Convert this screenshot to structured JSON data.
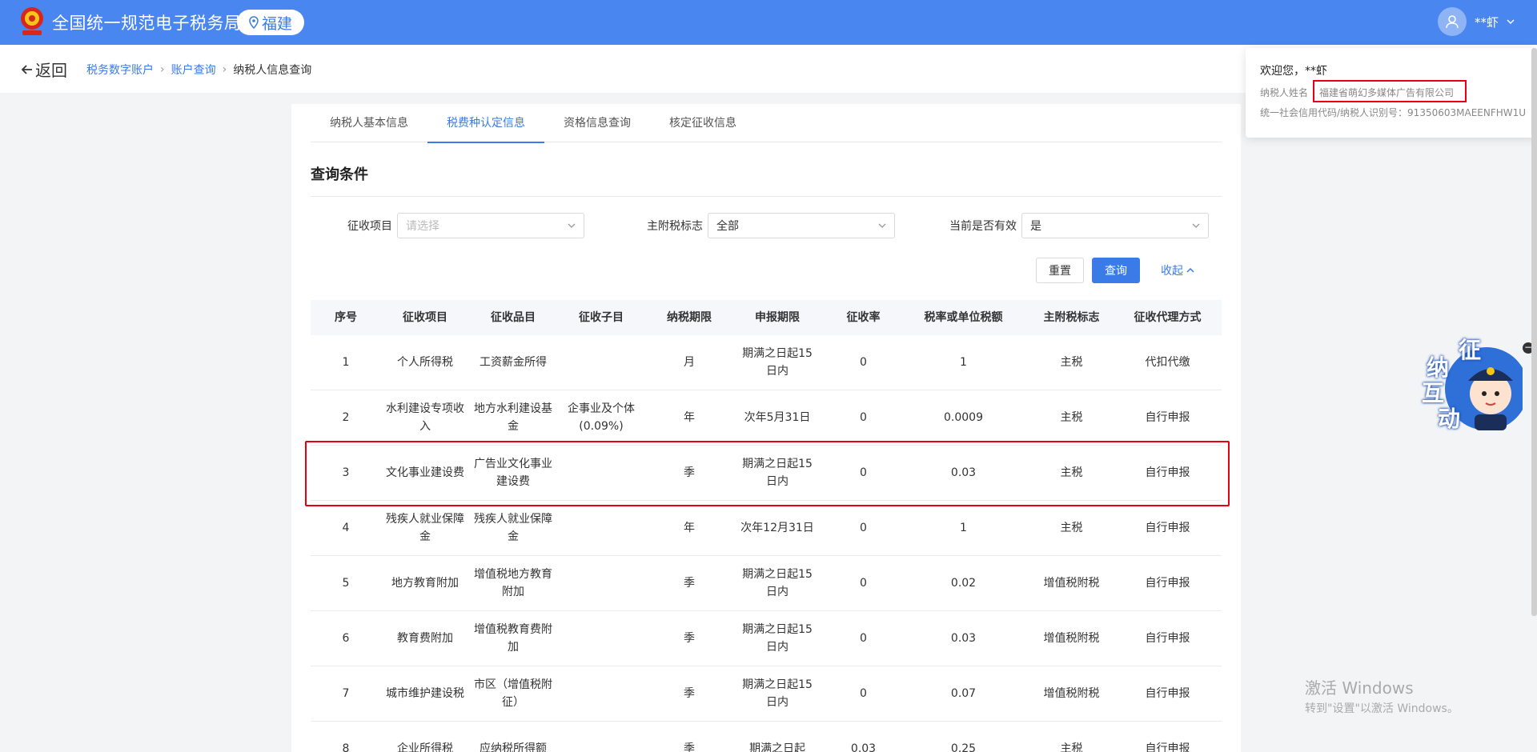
{
  "header": {
    "title": "全国统一规范电子税务局",
    "region": "福建",
    "user": "**虾"
  },
  "nav": {
    "back_label": "返回",
    "breadcrumb": [
      "税务数字账户",
      "账户查询",
      "纳税人信息查询"
    ]
  },
  "tabs": [
    "纳税人基本信息",
    "税费种认定信息",
    "资格信息查询",
    "核定征收信息"
  ],
  "query": {
    "title": "查询条件",
    "fields": [
      {
        "label": "征收项目",
        "value": "",
        "placeholder": "请选择"
      },
      {
        "label": "主附税标志",
        "value": "全部",
        "placeholder": ""
      },
      {
        "label": "当前是否有效",
        "value": "是",
        "placeholder": ""
      }
    ],
    "reset_label": "重置",
    "query_label": "查询",
    "collapse_label": "收起"
  },
  "table": {
    "columns": [
      "序号",
      "征收项目",
      "征收品目",
      "征收子目",
      "纳税期限",
      "申报期限",
      "征收率",
      "税率或单位税额",
      "主附税标志",
      "征收代理方式"
    ],
    "rows": [
      [
        "1",
        "个人所得税",
        "工资薪金所得",
        "",
        "月",
        "期满之日起15日内",
        "0",
        "1",
        "主税",
        "代扣代缴"
      ],
      [
        "2",
        "水利建设专项收入",
        "地方水利建设基金",
        "企事业及个体(0.09%)",
        "年",
        "次年5月31日",
        "0",
        "0.0009",
        "主税",
        "自行申报"
      ],
      [
        "3",
        "文化事业建设费",
        "广告业文化事业建设费",
        "",
        "季",
        "期满之日起15日内",
        "0",
        "0.03",
        "主税",
        "自行申报"
      ],
      [
        "4",
        "残疾人就业保障金",
        "残疾人就业保障金",
        "",
        "年",
        "次年12月31日",
        "0",
        "1",
        "主税",
        "自行申报"
      ],
      [
        "5",
        "地方教育附加",
        "增值税地方教育附加",
        "",
        "季",
        "期满之日起15日内",
        "0",
        "0.02",
        "增值税附税",
        "自行申报"
      ],
      [
        "6",
        "教育费附加",
        "增值税教育费附加",
        "",
        "季",
        "期满之日起15日内",
        "0",
        "0.03",
        "增值税附税",
        "自行申报"
      ],
      [
        "7",
        "城市维护建设税",
        "市区（增值税附征）",
        "",
        "季",
        "期满之日起15日内",
        "0",
        "0.07",
        "增值税附税",
        "自行申报"
      ],
      [
        "8",
        "企业所得税",
        "应纳税所得额",
        "",
        "季",
        "期满之日起",
        "0.03",
        "0.25",
        "主税",
        "自行申报"
      ]
    ]
  },
  "popup": {
    "welcome": "欢迎您，**虾",
    "name_label": "纳税人姓名",
    "name_value": "福建省萌幻多媒体广告有限公司",
    "credit_label": "统一社会信用代码/纳税人识别号：",
    "credit_value": "91350603MAEENFHW1U"
  },
  "widget": {
    "chars": [
      "征",
      "纳",
      "互",
      "动"
    ]
  },
  "watermark": {
    "line1": "激活 Windows",
    "line2": "转到\"设置\"以激活 Windows。"
  },
  "colors": {
    "primary": "#3a7be8",
    "header_bg": "#4a86f0",
    "highlight": "#e60012"
  }
}
